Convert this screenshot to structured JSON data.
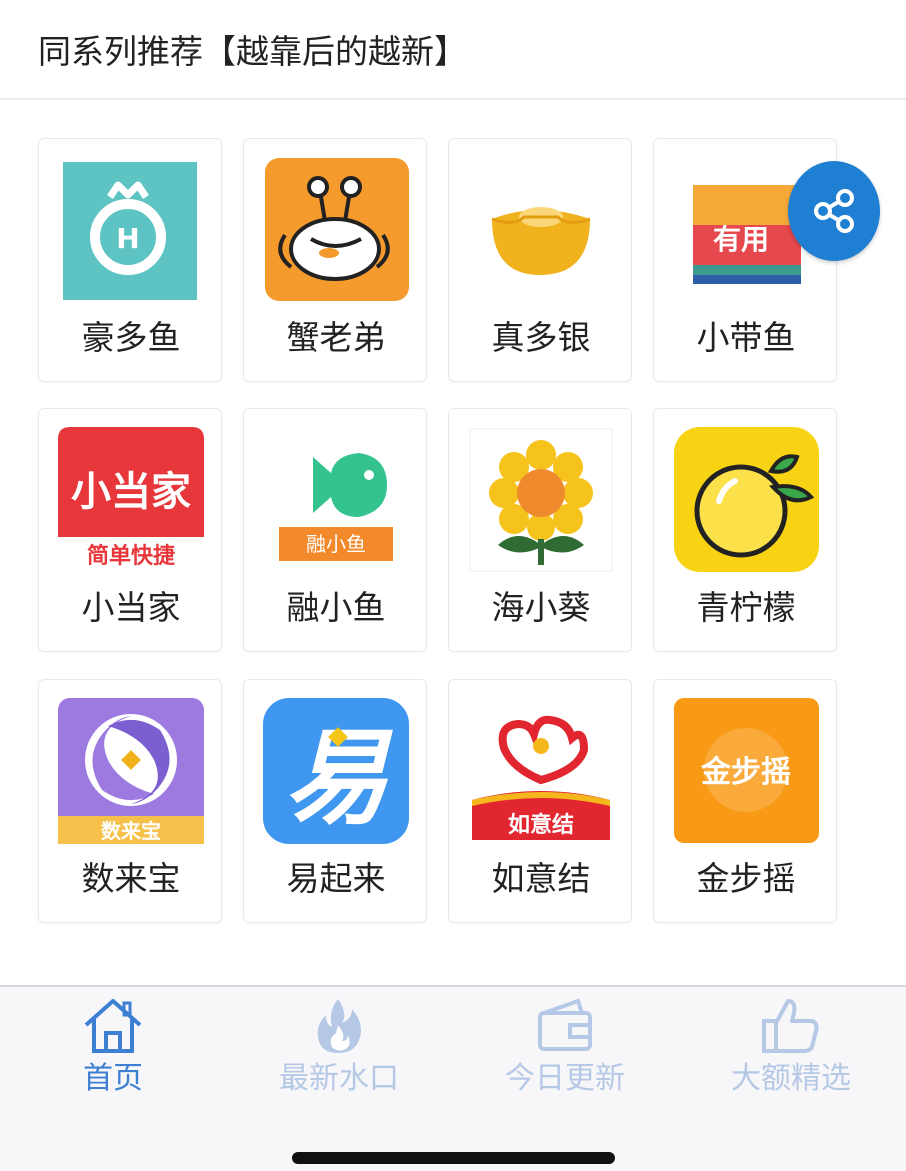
{
  "header": {
    "title": "同系列推荐【越靠后的越新】"
  },
  "apps": [
    {
      "name": "豪多鱼",
      "icon": "hao-duo-yu-app-icon",
      "icon_text": "H"
    },
    {
      "name": "蟹老弟",
      "icon": "xie-lao-di-app-icon",
      "icon_text": ""
    },
    {
      "name": "真多银",
      "icon": "zhen-duo-yin-app-icon",
      "icon_text": ""
    },
    {
      "name": "小带鱼",
      "icon": "xiao-dai-yu-app-icon",
      "icon_text": "有用"
    },
    {
      "name": "小当家",
      "icon": "xiao-dang-jia-app-icon",
      "icon_text": "小当家",
      "icon_subtext": "简单快捷"
    },
    {
      "name": "融小鱼",
      "icon": "rong-xiao-yu-app-icon",
      "icon_text": "融小鱼"
    },
    {
      "name": "海小葵",
      "icon": "hai-xiao-kui-app-icon",
      "icon_text": ""
    },
    {
      "name": "青柠檬",
      "icon": "qing-ning-meng-app-icon",
      "icon_text": ""
    },
    {
      "name": "数来宝",
      "icon": "shu-lai-bao-app-icon",
      "icon_text": "数来宝"
    },
    {
      "name": "易起来",
      "icon": "yi-qi-lai-app-icon",
      "icon_text": "易"
    },
    {
      "name": "如意结",
      "icon": "ru-yi-jie-app-icon",
      "icon_text": "如意结"
    },
    {
      "name": "金步摇",
      "icon": "jin-bu-yao-app-icon",
      "icon_text": "金步摇"
    }
  ],
  "share": {
    "icon": "share-icon"
  },
  "tabs": [
    {
      "label": "首页",
      "icon": "house-icon",
      "active": true
    },
    {
      "label": "最新水口",
      "icon": "flame-icon",
      "active": false
    },
    {
      "label": "今日更新",
      "icon": "wallet-icon",
      "active": false
    },
    {
      "label": "大额精选",
      "icon": "thumbs-up-icon",
      "active": false
    }
  ],
  "colors": {
    "tab_active": "#3d7fd1",
    "tab_inactive": "#b5c9e6",
    "share_bg": "#1f7fd3"
  }
}
